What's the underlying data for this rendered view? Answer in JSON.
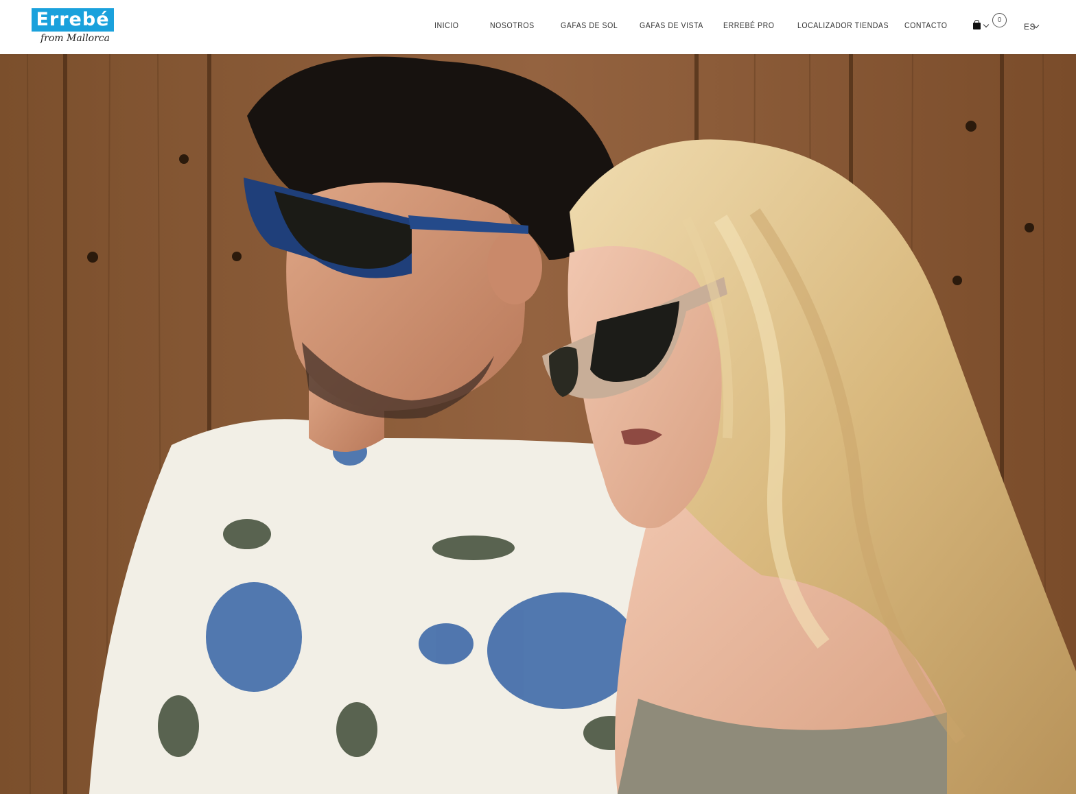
{
  "header": {
    "logo": {
      "brand": "Errebé",
      "tagline": "from Mallorca"
    },
    "nav": [
      {
        "label": "INICIO"
      },
      {
        "label": "NOSOTROS"
      },
      {
        "label": "GAFAS DE SOL"
      },
      {
        "label": "GAFAS DE VISTA"
      },
      {
        "label": "ERREBÉ PRO"
      },
      {
        "label": "LOCALIZADOR TIENDAS"
      },
      {
        "label": "CONTACTO"
      }
    ],
    "cart": {
      "icon": "shopping-bag-icon",
      "count": "0"
    },
    "language": {
      "selected": "ES"
    }
  },
  "colors": {
    "brand_blue": "#1aa1dc",
    "nav_text": "#333333"
  }
}
